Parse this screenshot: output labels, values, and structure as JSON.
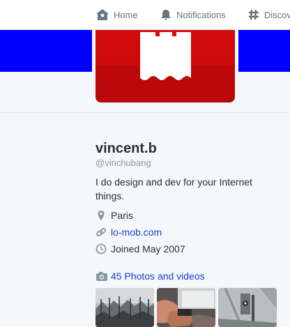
{
  "nav": {
    "items": [
      {
        "label": "Home",
        "icon": "home-icon"
      },
      {
        "label": "Notifications",
        "icon": "bell-icon"
      },
      {
        "label": "Discov",
        "icon": "hashtag-icon"
      }
    ]
  },
  "profile": {
    "name": "vincent.b",
    "handle": "@vinchubang",
    "bio": "I do design and dev for your Internet things.",
    "location": "Paris",
    "website": "lo-mob.com",
    "joined": "Joined May 2007"
  },
  "media": {
    "photos_label": "45 Photos and videos",
    "thumbnails": [
      {
        "icon": "photo-thumbnail-crowd"
      },
      {
        "icon": "photo-thumbnail-hands-device"
      },
      {
        "icon": "photo-thumbnail-metal-panel"
      }
    ]
  },
  "colors": {
    "accent_link": "#1b3ad6",
    "banner_blue": "#0000ff",
    "avatar_red": "#d60b0b"
  }
}
